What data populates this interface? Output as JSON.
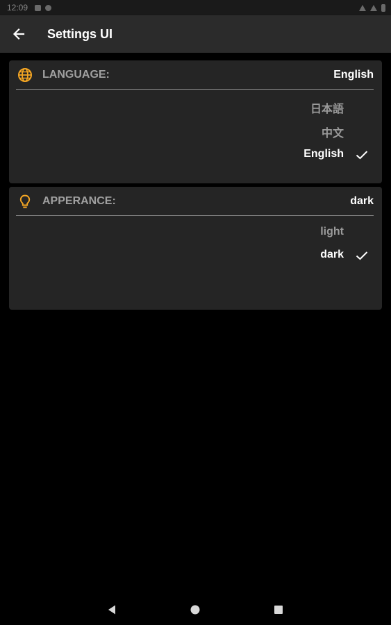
{
  "status_bar": {
    "time": "12:09",
    "icons": [
      "sim-card-icon",
      "sync-icon",
      "wifi-icon",
      "signal-icon",
      "battery-icon"
    ]
  },
  "app_bar": {
    "back_icon": "arrow-left-icon",
    "title": "Settings UI"
  },
  "language_section": {
    "icon": "globe-icon",
    "label": "LANGUAGE:",
    "current_value": "English",
    "options": [
      {
        "label": "日本語",
        "selected": false
      },
      {
        "label": "中文",
        "selected": false
      },
      {
        "label": "English",
        "selected": true
      }
    ]
  },
  "appearance_section": {
    "icon": "lightbulb-icon",
    "label": "APPERANCE:",
    "current_value": "dark",
    "options": [
      {
        "label": "light",
        "selected": false
      },
      {
        "label": "dark",
        "selected": true
      }
    ]
  },
  "nav_bar": {
    "icons": [
      "back-triangle-icon",
      "home-circle-icon",
      "recents-square-icon"
    ]
  },
  "colors": {
    "background": "#000000",
    "app_bar": "#2b2b2b",
    "card": "#252525",
    "accent": "#f5a623",
    "divider": "#8c8c8c",
    "muted_text": "#9a9a9a"
  }
}
